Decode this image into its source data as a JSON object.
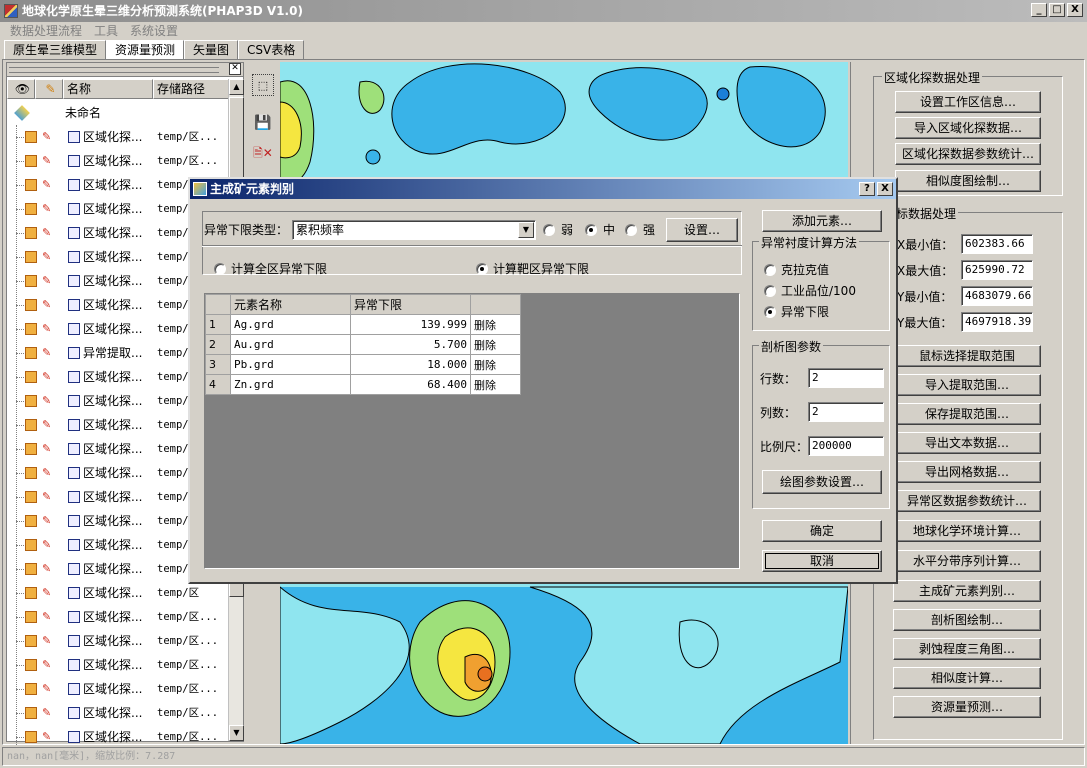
{
  "window": {
    "title": "地球化学原生晕三维分析预测系统(PHAP3D V1.0)",
    "controls": [
      "_",
      "□",
      "X"
    ]
  },
  "menu": [
    "数据处理流程",
    "工具",
    "系统设置"
  ],
  "tabs": [
    "原生晕三维模型",
    "资源量预测",
    "矢量图",
    "CSV表格"
  ],
  "layer_panel": {
    "columns": [
      "",
      "",
      "名称",
      "存储路径"
    ],
    "root": "未命名",
    "rows": [
      {
        "name": "区域化探...",
        "path": "temp/区..."
      },
      {
        "name": "区域化探...",
        "path": "temp/区..."
      },
      {
        "name": "区域化探...",
        "path": "temp/区"
      },
      {
        "name": "区域化探...",
        "path": "temp/区"
      },
      {
        "name": "区域化探...",
        "path": "temp/区"
      },
      {
        "name": "区域化探...",
        "path": "temp/区"
      },
      {
        "name": "区域化探...",
        "path": "temp/区"
      },
      {
        "name": "区域化探...",
        "path": "temp/区"
      },
      {
        "name": "区域化探...",
        "path": "temp/区"
      },
      {
        "name": "异常提取...",
        "path": "temp/异"
      },
      {
        "name": "区域化探...",
        "path": "temp/区"
      },
      {
        "name": "区域化探...",
        "path": "temp/区"
      },
      {
        "name": "区域化探...",
        "path": "temp/区"
      },
      {
        "name": "区域化探...",
        "path": "temp/区"
      },
      {
        "name": "区域化探...",
        "path": "temp/区"
      },
      {
        "name": "区域化探...",
        "path": "temp/区"
      },
      {
        "name": "区域化探...",
        "path": "temp/区"
      },
      {
        "name": "区域化探...",
        "path": "temp/区"
      },
      {
        "name": "区域化探...",
        "path": "temp/区"
      },
      {
        "name": "区域化探...",
        "path": "temp/区"
      },
      {
        "name": "区域化探...",
        "path": "temp/区..."
      },
      {
        "name": "区域化探...",
        "path": "temp/区..."
      },
      {
        "name": "区域化探...",
        "path": "temp/区..."
      },
      {
        "name": "区域化探...",
        "path": "temp/区..."
      },
      {
        "name": "区域化探...",
        "path": "temp/区..."
      },
      {
        "name": "区域化探...",
        "path": "temp/区..."
      }
    ]
  },
  "right_panel": {
    "group1_title": "区域化探数据处理",
    "group1_buttons": [
      "设置工作区信息…",
      "导入区域化探数据…",
      "区域化探数据参数统计…",
      "相似度图绘制…"
    ],
    "group2_title": "目标数据处理",
    "fields": [
      {
        "label": "X最小值：",
        "value": "602383.66"
      },
      {
        "label": "X最大值：",
        "value": "625990.72"
      },
      {
        "label": "Y最小值：",
        "value": "4683079.66"
      },
      {
        "label": "Y最大值：",
        "value": "4697918.39"
      }
    ],
    "group2_buttons": [
      "鼠标选择提取范围",
      "导入提取范围…",
      "保存提取范围…",
      "导出文本数据…",
      "导出网格数据…",
      "异常区数据参数统计…",
      "地球化学环境计算…",
      "水平分带序列计算…",
      "主成矿元素判别…",
      "剖析图绘制…",
      "剥蚀程度三角图…",
      "相似度计算…",
      "资源量预测…"
    ]
  },
  "dialog": {
    "title": "主成矿元素判别",
    "title_buttons": [
      "?",
      "X"
    ],
    "threshold_type_label": "异常下限类型：",
    "threshold_type_value": "累积频率",
    "strength_options": [
      "弱",
      "中",
      "强"
    ],
    "strength_selected": "中",
    "settings_button": "设置…",
    "scope_options": [
      "计算全区异常下限",
      "计算靶区异常下限"
    ],
    "scope_selected": "计算靶区异常下限",
    "table_headers": [
      "",
      "元素名称",
      "异常下限",
      ""
    ],
    "table_rows": [
      {
        "n": "1",
        "element": "Ag.grd",
        "threshold": "139.999",
        "action": "删除"
      },
      {
        "n": "2",
        "element": "Au.grd",
        "threshold": "5.700",
        "action": "删除"
      },
      {
        "n": "3",
        "element": "Pb.grd",
        "threshold": "18.000",
        "action": "删除"
      },
      {
        "n": "4",
        "element": "Zn.grd",
        "threshold": "68.400",
        "action": "删除"
      }
    ],
    "add_element_button": "添加元素…",
    "method_group_title": "异常衬度计算方法",
    "method_options": [
      "克拉克值",
      "工业品位/100",
      "异常下限"
    ],
    "method_selected": "异常下限",
    "section_group_title": "剖析图参数",
    "section_fields": [
      {
        "label": "行数：",
        "value": "2"
      },
      {
        "label": "列数：",
        "value": "2"
      },
      {
        "label": "比例尺：",
        "value": "200000"
      }
    ],
    "plot_params_button": "绘图参数设置…",
    "ok_button": "确定",
    "cancel_button": "取消"
  },
  "status": "nan，nan[毫米]，缩放比例：7.287",
  "colors": {
    "titlebar": "#8c8c8c",
    "dialog_title": "#0a246a",
    "map_water": "#8fe5ef",
    "map_mid": "#39b3e8",
    "map_high": "#9ee07a",
    "map_peak": "#f5e640",
    "map_core": "#f0a030"
  }
}
